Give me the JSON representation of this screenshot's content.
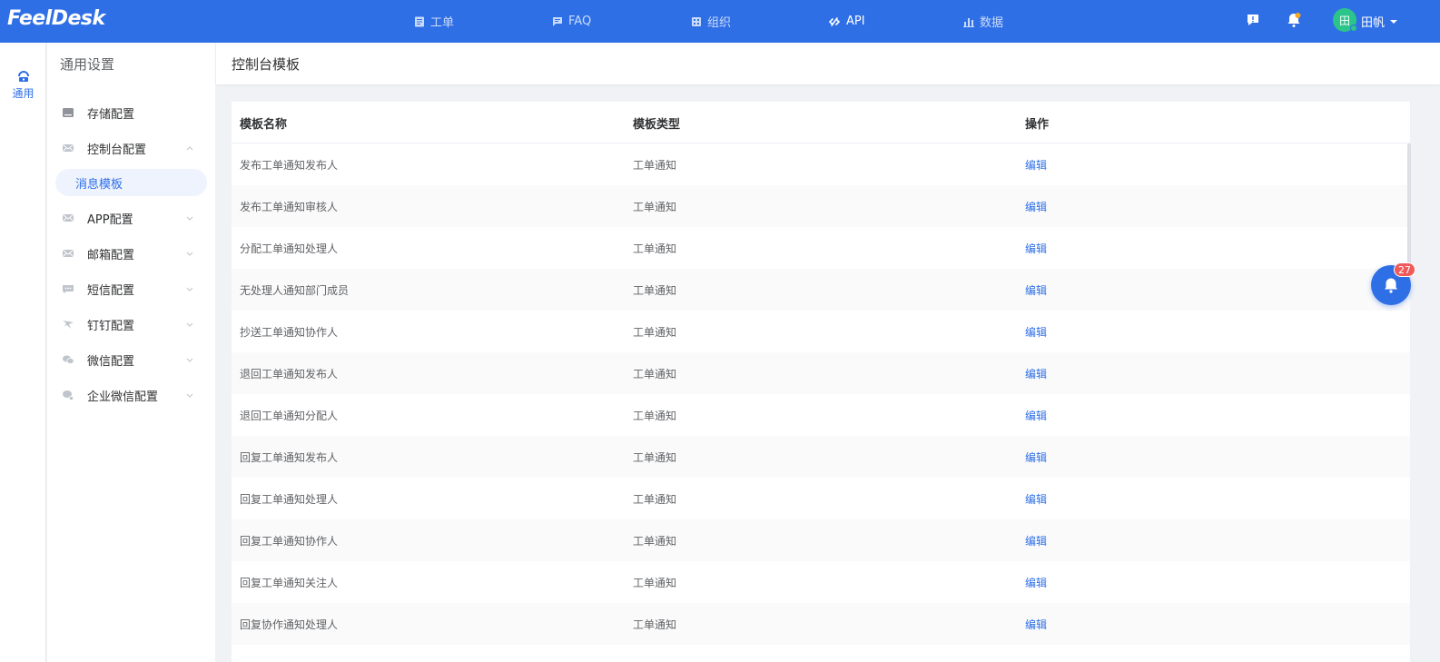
{
  "app": {
    "logo": "FeelDesk"
  },
  "topnav": {
    "items": [
      {
        "label": "工单",
        "icon": "document-icon",
        "active": false
      },
      {
        "label": "FAQ",
        "icon": "chat-icon",
        "active": false
      },
      {
        "label": "组织",
        "icon": "building-icon",
        "active": false
      },
      {
        "label": "API",
        "icon": "link-icon",
        "active": true
      },
      {
        "label": "数据",
        "icon": "bar-chart-icon",
        "active": false
      }
    ]
  },
  "user": {
    "avatar_text": "田",
    "name": "田帆"
  },
  "rail": {
    "item_label": "通用",
    "icon": "settings-general-icon"
  },
  "sidebar": {
    "title": "通用设置",
    "items": [
      {
        "label": "存储配置",
        "icon": "storage-icon",
        "chevron": ""
      },
      {
        "label": "控制台配置",
        "icon": "mail-icon",
        "chevron": "up"
      },
      {
        "label": "APP配置",
        "icon": "mail-icon",
        "chevron": "down"
      },
      {
        "label": "邮箱配置",
        "icon": "mail-icon",
        "chevron": "down"
      },
      {
        "label": "短信配置",
        "icon": "sms-icon",
        "chevron": "down"
      },
      {
        "label": "钉钉配置",
        "icon": "dingtalk-icon",
        "chevron": "down"
      },
      {
        "label": "微信配置",
        "icon": "wechat-icon",
        "chevron": "down"
      },
      {
        "label": "企业微信配置",
        "icon": "wecom-icon",
        "chevron": "down"
      }
    ],
    "subitem": "消息模板"
  },
  "main": {
    "title": "控制台模板"
  },
  "table": {
    "columns": [
      "模板名称",
      "模板类型",
      "操作"
    ],
    "rows": [
      {
        "name": "发布工单通知发布人",
        "type": "工单通知",
        "action": "编辑"
      },
      {
        "name": "发布工单通知审核人",
        "type": "工单通知",
        "action": "编辑"
      },
      {
        "name": "分配工单通知处理人",
        "type": "工单通知",
        "action": "编辑"
      },
      {
        "name": "无处理人通知部门成员",
        "type": "工单通知",
        "action": "编辑"
      },
      {
        "name": "抄送工单通知协作人",
        "type": "工单通知",
        "action": "编辑"
      },
      {
        "name": "退回工单通知发布人",
        "type": "工单通知",
        "action": "编辑"
      },
      {
        "name": "退回工单通知分配人",
        "type": "工单通知",
        "action": "编辑"
      },
      {
        "name": "回复工单通知发布人",
        "type": "工单通知",
        "action": "编辑"
      },
      {
        "name": "回复工单通知处理人",
        "type": "工单通知",
        "action": "编辑"
      },
      {
        "name": "回复工单通知协作人",
        "type": "工单通知",
        "action": "编辑"
      },
      {
        "name": "回复工单通知关注人",
        "type": "工单通知",
        "action": "编辑"
      },
      {
        "name": "回复协作通知处理人",
        "type": "工单通知",
        "action": "编辑"
      }
    ]
  },
  "notification": {
    "count": "27"
  },
  "colors": {
    "primary": "#2f6fe6",
    "badge": "#f05a5a",
    "avatar": "#2bc48a"
  }
}
